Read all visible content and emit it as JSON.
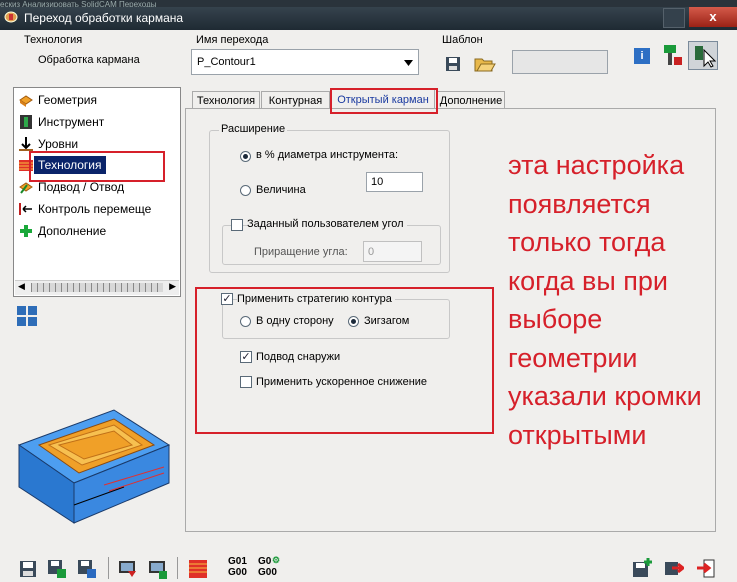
{
  "window": {
    "title": "Переход обработки кармана",
    "top_stripe": "ескиз  Анализировать  SolidCAM  Переходы",
    "close_glyph": "x"
  },
  "header": {
    "technology_label": "Технология",
    "technology_value": "Обработка кармана",
    "operation_name_label": "Имя перехода",
    "operation_name_value": "P_Contour1",
    "template_label": "Шаблон",
    "info_glyph": "i"
  },
  "tree": {
    "items": [
      {
        "label": "Геометрия",
        "icon": "geometry-icon"
      },
      {
        "label": "Инструмент",
        "icon": "tool-icon"
      },
      {
        "label": "Уровни",
        "icon": "levels-icon"
      },
      {
        "label": "Технология",
        "icon": "technology-icon",
        "selected": true
      },
      {
        "label": "Подвод / Отвод",
        "icon": "link-icon"
      },
      {
        "label": "Контроль перемеще",
        "icon": "motion-control-icon"
      },
      {
        "label": "Дополнение",
        "icon": "misc-plus-icon"
      }
    ]
  },
  "tabs": [
    {
      "label": "Технология"
    },
    {
      "label": "Контурная"
    },
    {
      "label": "Открытый карман",
      "active": true
    },
    {
      "label": "Дополнение"
    }
  ],
  "expansion": {
    "group_label": "Расширение",
    "radio_percent_label": "в % диаметра инструмента:",
    "radio_percent_checked": true,
    "radio_value_label": "Величина",
    "radio_value_checked": false,
    "value": "10",
    "user_angle_label": "Заданный пользователем угол",
    "user_angle_checked": false,
    "angle_increment_label": "Приращение угла:",
    "angle_increment_value": "0"
  },
  "contour_strategy": {
    "apply_label": "Применить стратегию контура",
    "apply_checked": true,
    "one_way_label": "В одну сторону",
    "one_way_checked": false,
    "zigzag_label": "Зигзагом",
    "zigzag_checked": true,
    "approach_outside_label": "Подвод снаружи",
    "approach_outside_checked": true,
    "fast_descent_label": "Применить ускоренное снижение",
    "fast_descent_checked": false
  },
  "annotation": {
    "lines": [
      "эта настройка",
      "появляется",
      "только тогда",
      "когда вы при",
      "выборе",
      "геометрии",
      "указали кромки",
      "открытыми"
    ],
    "color": "#d6202a"
  },
  "bottom_toolbar": {
    "g01_label": "G01",
    "g00_label": "G00",
    "g00b_label": "G0",
    "g00c_label": "G00"
  },
  "colors": {
    "accent_red": "#d6202a",
    "selection_blue": "#0a246a",
    "part_blue": "#3d8fe0",
    "part_orange": "#f0a028"
  }
}
